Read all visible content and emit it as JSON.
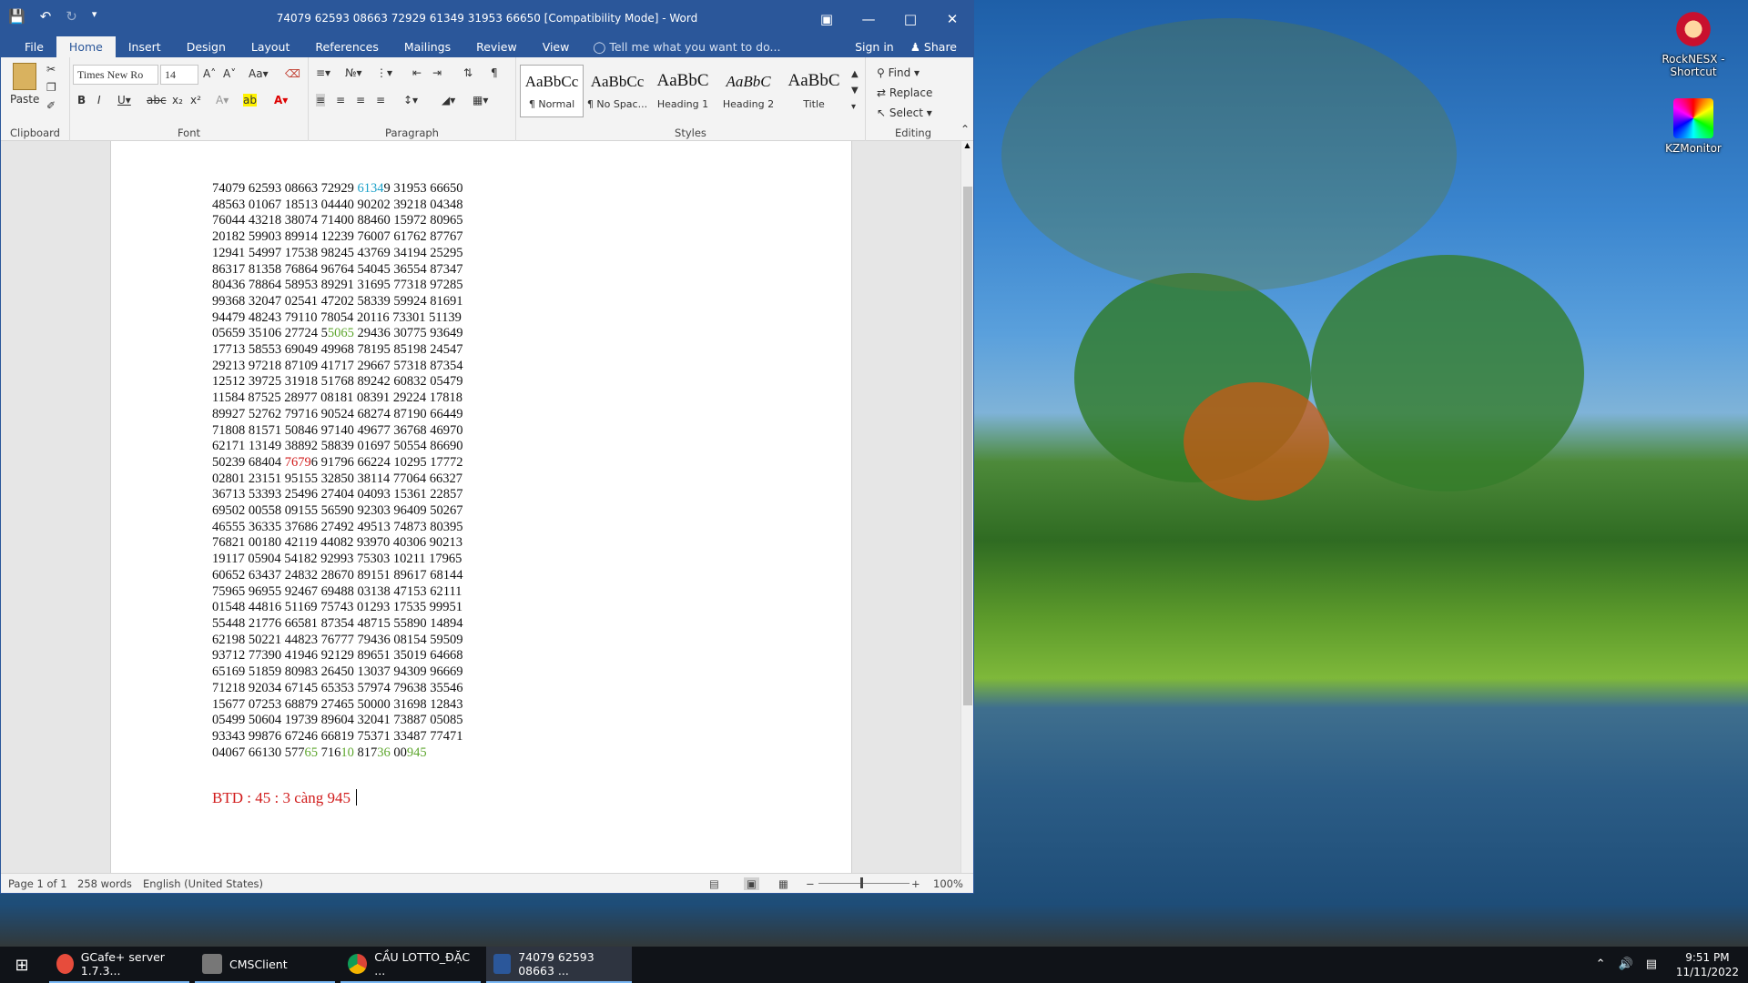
{
  "window": {
    "title": "74079 62593 08663 72929 61349 31953 66650 [Compatibility Mode] - Word"
  },
  "menu": {
    "tabs": [
      "File",
      "Home",
      "Insert",
      "Design",
      "Layout",
      "References",
      "Mailings",
      "Review",
      "View"
    ],
    "active_tab": "Home",
    "tell_me": "Tell me what you want to do...",
    "sign_in": "Sign in",
    "share": "Share"
  },
  "ribbon": {
    "clipboard": {
      "label": "Clipboard",
      "paste": "Paste"
    },
    "font": {
      "label": "Font",
      "name": "Times New Ro",
      "size": "14"
    },
    "paragraph": {
      "label": "Paragraph"
    },
    "styles": {
      "label": "Styles",
      "items": [
        {
          "sample": "AaBbCc",
          "name": "¶ Normal"
        },
        {
          "sample": "AaBbCc",
          "name": "¶ No Spac..."
        },
        {
          "sample": "AaBbC",
          "name": "Heading 1"
        },
        {
          "sample": "AaBbC",
          "name": "Heading 2"
        },
        {
          "sample": "AaBbC",
          "name": "Title"
        }
      ]
    },
    "editing": {
      "label": "Editing",
      "find": "Find",
      "replace": "Replace",
      "select": "Select"
    }
  },
  "document": {
    "lines": [
      "74079 62593 08663 72929 ",
      "48563 01067 18513 04440 90202 39218 04348",
      "76044 43218 38074 71400 88460 15972 80965",
      "20182 59903 89914 12239 76007 61762 87767",
      "12941 54997 17538 98245 43769 34194 25295",
      "86317 81358 76864 96764 54045 36554 87347",
      "80436 78864 58953 89291 31695 77318 97285",
      "99368 32047 02541 47202 58339 59924 81691",
      "94479 48243 79110 78054 20116 73301 51139",
      "05659 35106 27724 5",
      "17713 58553 69049 49968 78195 85198 24547",
      "29213 97218 87109 41717 29667 57318 87354",
      "12512 39725 31918 51768 89242 60832 05479",
      "11584 87525 28977 08181 08391 29224 17818",
      "89927 52762 79716 90524 68274 87190 66449",
      "71808 81571 50846 97140 49677 36768 46970",
      "62171 13149 38892 58839 01697 50554 86690",
      "50239 68404 ",
      "02801 23151 95155 32850 38114 77064 66327",
      "36713 53393 25496 27404 04093 15361 22857",
      "69502 00558 09155 56590 92303 96409 50267",
      "46555 36335 37686 27492 49513 74873 80395",
      "76821 00180 42119 44082 93970 40306 90213",
      "19117 05904 54182 92993 75303 10211 17965",
      "60652 63437 24832 28670 89151 89617 68144",
      "75965 96955 92467 69488 03138 47153 62111",
      "01548 44816 51169 75743 01293 17535 99951",
      "55448 21776 66581 87354 48715 55890 14894",
      "62198 50221 44823 76777 79436 08154 59509",
      "93712 77390 41946 92129 89651 35019 64668",
      "65169 51859 80983 26450 13037 94309 96669",
      "71218 92034 67145 65353 57974 79638 35546",
      "15677 07253 68879 27465 50000 31698 12843",
      "05499 50604 19739 89604 32041 73887 05085",
      "93343 99876 67246 66819 75371 33487 77471",
      "04067 66130 577"
    ],
    "line1_hl": "6134",
    "line1_rest": "9 31953 66650",
    "line10_hl": "5065",
    "line10_rest": " 29436 30775 93649",
    "line18_hl": "7679",
    "line18_rest": "6 91796 66224 10295 17772",
    "last_a": "65",
    "last_b": " 716",
    "last_c": "10",
    "last_d": " 817",
    "last_e": "36",
    "last_f": " 00",
    "last_g": "945",
    "btd": "BTD : 45 : 3 càng 945"
  },
  "status": {
    "page": "Page 1 of 1",
    "words": "258 words",
    "language": "English (United States)",
    "zoom": "100%"
  },
  "desktop": {
    "icons": [
      {
        "label": "RockNESX - Shortcut"
      },
      {
        "label": "KZMonitor"
      }
    ]
  },
  "taskbar": {
    "items": [
      {
        "label": "GCafe+ server 1.7.3..."
      },
      {
        "label": "CMSClient"
      },
      {
        "label": "CẦU LOTTO_ĐẶC ..."
      },
      {
        "label": "74079 62593 08663 ..."
      }
    ],
    "time": "9:51 PM",
    "date": "11/11/2022"
  }
}
